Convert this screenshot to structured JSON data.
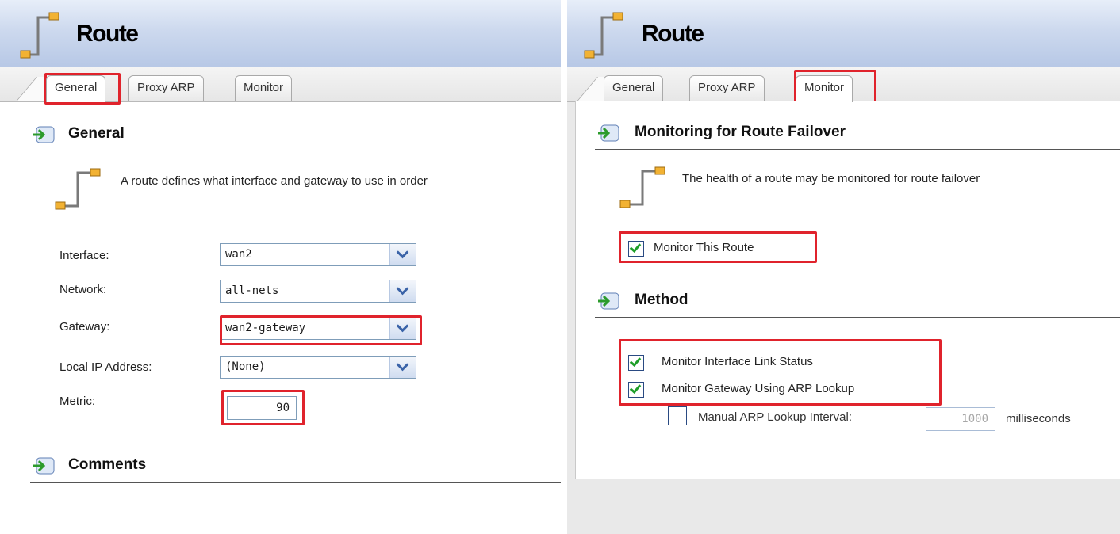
{
  "left_panel": {
    "title": "Route",
    "tabs": [
      "General",
      "Proxy ARP",
      "Monitor"
    ],
    "active_tab": "General",
    "section_general": "General",
    "description": "A route defines what interface and gateway to use in order",
    "fields": {
      "interface": {
        "label": "Interface:",
        "value": "wan2"
      },
      "network": {
        "label": "Network:",
        "value": "all-nets"
      },
      "gateway": {
        "label": "Gateway:",
        "value": "wan2-gateway"
      },
      "local_ip": {
        "label": "Local IP Address:",
        "value": "(None)"
      },
      "metric": {
        "label": "Metric:",
        "value": "90"
      }
    },
    "section_comments": "Comments"
  },
  "right_panel": {
    "title": "Route",
    "tabs": [
      "General",
      "Proxy ARP",
      "Monitor"
    ],
    "active_tab": "Monitor",
    "section_monitoring": "Monitoring for Route Failover",
    "description": "The health of a route may be monitored for route failover",
    "monitor_this_route": {
      "label": "Monitor This Route",
      "checked": true
    },
    "section_method": "Method",
    "monitor_link_status": {
      "label": "Monitor Interface Link Status",
      "checked": true
    },
    "monitor_gateway_arp": {
      "label": "Monitor Gateway Using ARP Lookup",
      "checked": true
    },
    "manual_arp": {
      "label": "Manual ARP Lookup Interval:",
      "checked": false,
      "value": "1000",
      "unit": "milliseconds"
    }
  },
  "colors": {
    "highlight": "#e0232c",
    "title_gradient": "#cdd9ee",
    "check": "#1e9e28"
  }
}
